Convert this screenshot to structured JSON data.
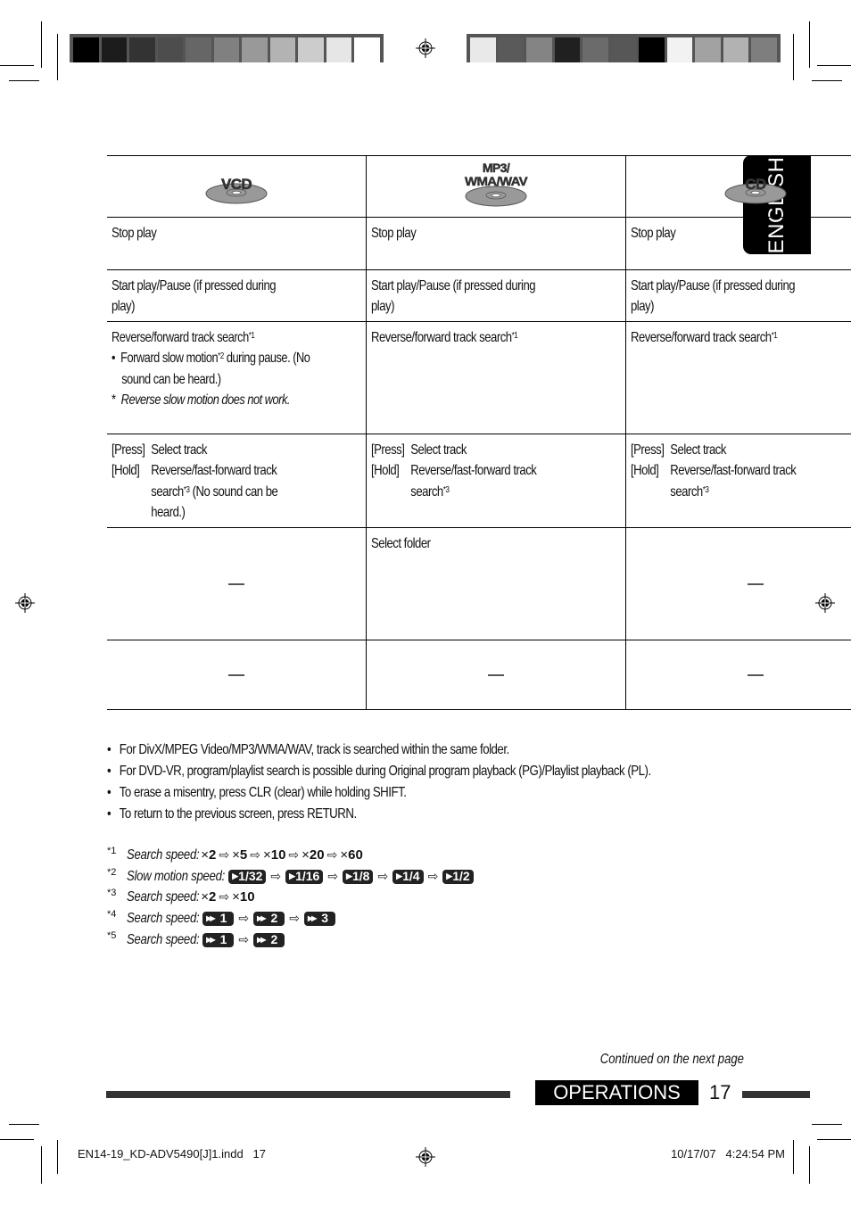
{
  "print_marks": {
    "left_swatches": [
      "#000000",
      "#1c1c1c",
      "#333333",
      "#4d4d4d",
      "#666666",
      "#808080",
      "#999999",
      "#b3b3b3",
      "#cccccc",
      "#e6e6e6",
      "#ffffff"
    ],
    "right_swatches": [
      "#e9e9e9",
      "#5a5a5a",
      "#848484",
      "#202020",
      "#6b6b6b",
      "#575757",
      "#000000",
      "#f2f2f2",
      "#a2a2a2",
      "#b2b2b2",
      "#7e7e7e"
    ]
  },
  "side_tab": {
    "label": "ENGLISH"
  },
  "table": {
    "columns": [
      {
        "disc_label_line1": "VCD",
        "disc_label_line2": ""
      },
      {
        "disc_label_line1": "MP3/",
        "disc_label_line2": "WMA/WAV"
      },
      {
        "disc_label_line1": "CD",
        "disc_label_line2": ""
      }
    ],
    "rows": [
      {
        "cells": [
          "Stop play",
          "Stop play",
          "Stop play"
        ]
      },
      {
        "cells": [
          "Start play/Pause (if pressed during play)",
          "Start play/Pause (if pressed during play)",
          "Start play/Pause (if pressed during play)"
        ]
      },
      {
        "vcd": {
          "main": "Reverse/forward track search",
          "main_ref": "*1",
          "bullet_text": "Forward slow motion",
          "bullet_ref": "*2",
          "bullet_rest": " during pause. (No sound can be heard.)",
          "note_mark": "*",
          "note_text": "Reverse slow motion does not work."
        },
        "mp3": {
          "main": "Reverse/forward track search",
          "main_ref": "*1"
        },
        "cd": {
          "main": "Reverse/forward track search",
          "main_ref": "*1"
        }
      },
      {
        "press_key": "[Press]",
        "press_text": "Select track",
        "hold_key": "[Hold]",
        "vcd_hold": "Reverse/fast-forward track search",
        "vcd_hold_ref": "*3",
        "vcd_hold_rest": " (No sound can be heard.)",
        "mp3_hold": "Reverse/fast-forward track search",
        "mp3_hold_ref": "*3",
        "cd_hold": "Reverse/fast-forward track search",
        "cd_hold_ref": "*3"
      },
      {
        "cells": [
          "—",
          "Select folder",
          "—"
        ]
      },
      {
        "cells": [
          "—",
          "—",
          "—"
        ]
      }
    ]
  },
  "notes": [
    "For DivX/MPEG Video/MP3/WMA/WAV, track is searched within the same folder.",
    "For DVD-VR, program/playlist search is possible during Original program playback (PG)/Playlist playback (PL).",
    "To erase a misentry, press CLR (clear) while holding SHIFT.",
    "To return to the previous screen, press RETURN."
  ],
  "footnotes": [
    {
      "mark": "*1",
      "label": "Search speed:",
      "steps": [
        "×2",
        "×5",
        "×10",
        "×20",
        "×60"
      ]
    },
    {
      "mark": "*2",
      "label": "Slow motion speed:",
      "steps": [
        "1/32",
        "1/16",
        "1/8",
        "1/4",
        "1/2"
      ]
    },
    {
      "mark": "*3",
      "label": "Search speed:",
      "steps": [
        "×2",
        "×10"
      ]
    },
    {
      "mark": "*4",
      "label": "Search speed:",
      "steps": [
        "1",
        "2",
        "3"
      ]
    },
    {
      "mark": "*5",
      "label": "Search speed:",
      "steps": [
        "1",
        "2"
      ]
    }
  ],
  "footer": {
    "continued": "Continued on the next page",
    "section": "OPERATIONS",
    "page_number": "17",
    "file_name": "EN14-19_KD-ADV5490[J]1.indd   17",
    "timestamp": "10/17/07   4:24:54 PM"
  }
}
